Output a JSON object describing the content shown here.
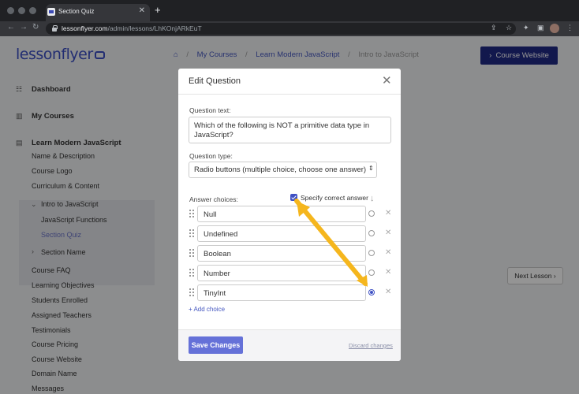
{
  "browser": {
    "tab_title": "Section Quiz",
    "url_host": "lessonflyer.com",
    "url_path": "/admin/lessons/LhKOnjARkEuT"
  },
  "header": {
    "logo": "lessonflyer",
    "breadcrumbs": [
      "My Courses",
      "Learn Modern JavaScript",
      "Intro to JavaScript"
    ],
    "course_site_button": "Course Website"
  },
  "sidebar": {
    "dashboard": "Dashboard",
    "my_courses": "My Courses",
    "course_title": "Learn Modern JavaScript",
    "items_top": [
      "Name & Description",
      "Course Logo",
      "Curriculum & Content"
    ],
    "section_open": "Intro to JavaScript",
    "section_lessons": [
      "JavaScript Functions",
      "Section Quiz"
    ],
    "section_closed": "Section Name",
    "items_bottom": [
      "Course FAQ",
      "Learning Objectives",
      "Students Enrolled",
      "Assigned Teachers",
      "Testimonials",
      "Course Pricing",
      "Course Website",
      "Domain Name",
      "Messages"
    ]
  },
  "main": {
    "next_lesson_button": "Next Lesson"
  },
  "modal": {
    "title": "Edit Question",
    "question_label": "Question text:",
    "question_value": "Which of the following is NOT a primitive data type in JavaScript?",
    "type_label": "Question type:",
    "type_value": "Radio buttons (multiple choice, choose one answer)",
    "choices_label": "Answer choices:",
    "specify_label": "Specify correct answer",
    "choices": [
      "Null",
      "Undefined",
      "Boolean",
      "Number",
      "TinyInt"
    ],
    "correct_index": 4,
    "add_choice": "+ Add choice",
    "save_button": "Save Changes",
    "discard_link": "Discard changes"
  },
  "colors": {
    "brand": "#3b4fc4",
    "primary_button": "#6571d8",
    "arrow": "#f5b61d"
  }
}
